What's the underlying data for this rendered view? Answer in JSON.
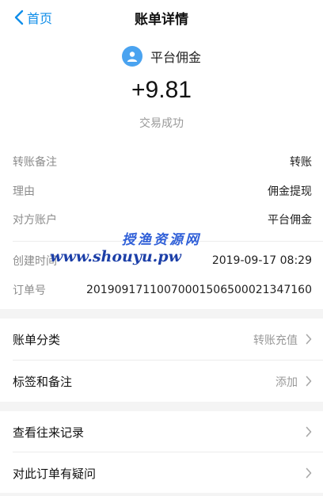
{
  "nav": {
    "back_label": "首页",
    "title": "账单详情"
  },
  "summary": {
    "payee": "平台佣金",
    "amount": "+9.81",
    "status": "交易成功"
  },
  "details": {
    "rows": [
      {
        "label": "转账备注",
        "value": "转账"
      },
      {
        "label": "理由",
        "value": "佣金提现"
      },
      {
        "label": "对方账户",
        "value": "平台佣金"
      },
      {
        "label": "创建时间",
        "value": "2019-09-17 08:29"
      },
      {
        "label": "订单号",
        "value": "2019091711007000150650002134716​0"
      }
    ]
  },
  "watermark": {
    "title": "授渔资源网",
    "url": "www.shouyu.pw"
  },
  "actions": {
    "category_label": "账单分类",
    "category_value": "转账充值",
    "tags_label": "标签和备注",
    "tags_value": "添加",
    "history_label": "查看往来记录",
    "question_label": "对此订单有疑问"
  },
  "colors": {
    "accent": "#108ee9",
    "avatar": "#4aa3f0",
    "watermark": "#2f5fd8"
  }
}
